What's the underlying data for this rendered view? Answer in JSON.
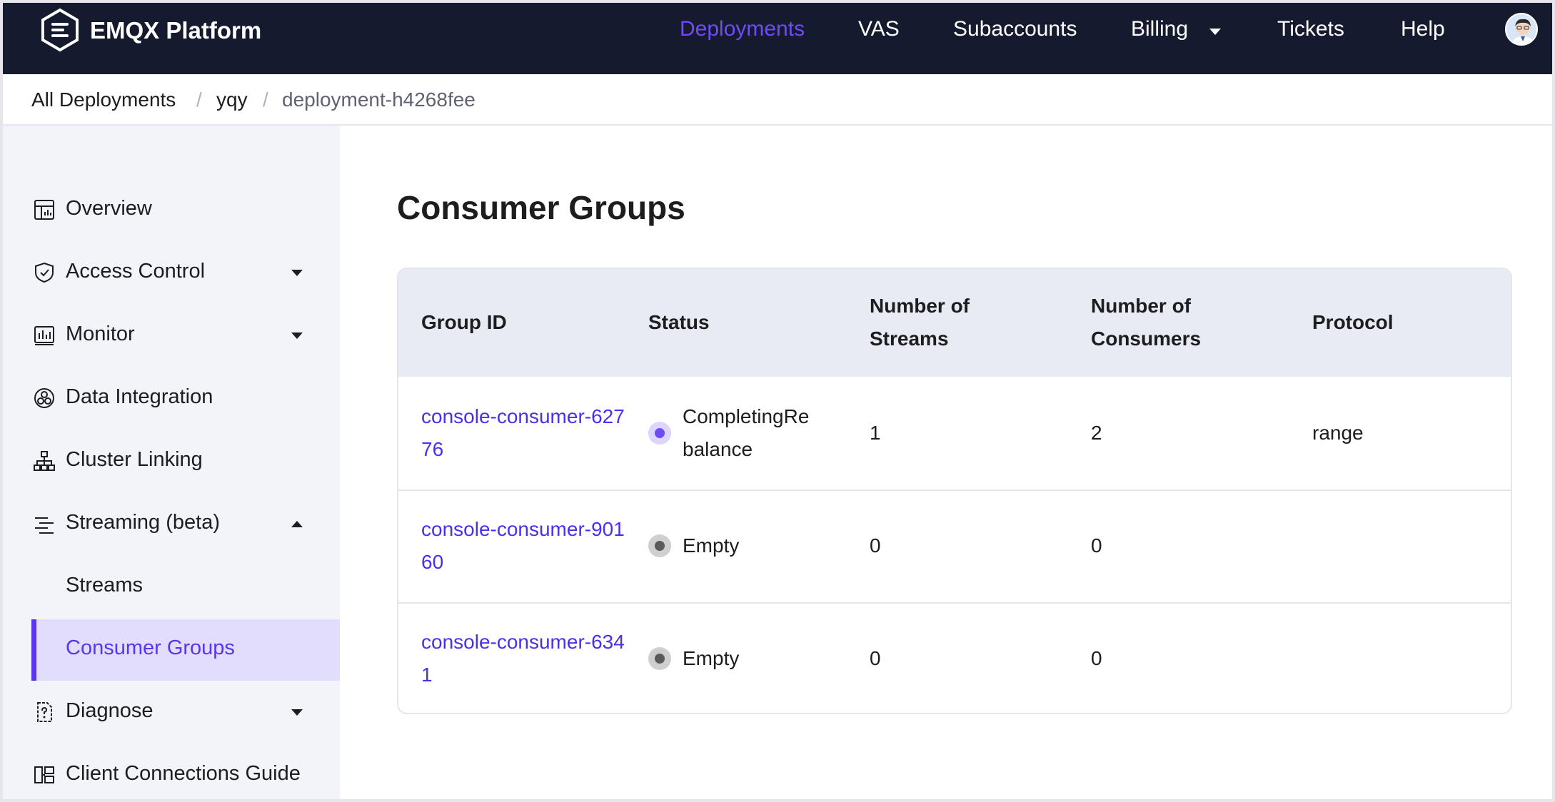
{
  "header": {
    "brand": "EMQX Platform",
    "nav": {
      "deployments": "Deployments",
      "vas": "VAS",
      "subaccounts": "Subaccounts",
      "billing": "Billing",
      "tickets": "Tickets",
      "help": "Help"
    },
    "active_nav": "Deployments",
    "accent_color": "#6d4cf6",
    "bar_color": "#161a2e"
  },
  "breadcrumb": {
    "items": [
      "All Deployments",
      "yqy",
      "deployment-h4268fee"
    ],
    "separator": "/"
  },
  "sidebar": {
    "items": [
      {
        "label": "Overview",
        "icon": "dashboard-icon"
      },
      {
        "label": "Access Control",
        "icon": "shield-check-icon",
        "expandable": true
      },
      {
        "label": "Monitor",
        "icon": "bar-chart-icon",
        "expandable": true
      },
      {
        "label": "Data Integration",
        "icon": "integration-icon"
      },
      {
        "label": "Cluster Linking",
        "icon": "hierarchy-icon"
      },
      {
        "label": "Streaming (beta)",
        "icon": "streaming-icon",
        "expandable": true,
        "expanded": true
      },
      {
        "label": "Diagnose",
        "icon": "diagnose-file-icon",
        "expandable": true
      },
      {
        "label": "Client Connections Guide",
        "icon": "guide-icon"
      }
    ],
    "streaming_children": [
      {
        "label": "Streams"
      },
      {
        "label": "Consumer Groups",
        "active": true
      }
    ]
  },
  "main": {
    "title": "Consumer Groups",
    "columns": [
      "Group ID",
      "Status",
      "Number of Streams",
      "Number of Consumers",
      "Protocol"
    ],
    "rows": [
      {
        "group_id": "console-consumer-62776",
        "status": "CompletingRebalance",
        "status_color": "#6d4cf6",
        "streams": "1",
        "consumers": "2",
        "protocol": "range"
      },
      {
        "group_id": "console-consumer-90160",
        "status": "Empty",
        "status_color": "#5a5a5a",
        "streams": "0",
        "consumers": "0",
        "protocol": ""
      },
      {
        "group_id": "console-consumer-6341",
        "status": "Empty",
        "status_color": "#5a5a5a",
        "streams": "0",
        "consumers": "0",
        "protocol": ""
      }
    ]
  }
}
